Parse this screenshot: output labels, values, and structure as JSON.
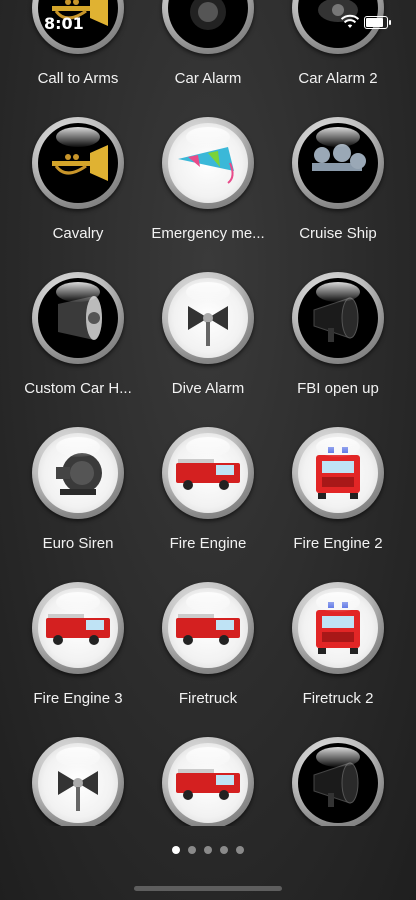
{
  "status_bar": {
    "time": "8:01"
  },
  "rows": [
    [
      "Call to Arms",
      "Car Alarm",
      "Car Alarm 2"
    ],
    [
      "Cavalry",
      "Emergency me...",
      "Cruise Ship"
    ],
    [
      "Custom Car H...",
      "Dive Alarm",
      "FBI open up"
    ],
    [
      "Euro Siren",
      "Fire Engine",
      "Fire Engine 2"
    ],
    [
      "Fire Engine 3",
      "Firetruck",
      "Firetruck 2"
    ],
    [
      "",
      "",
      ""
    ]
  ],
  "icons": [
    [
      "trumpet-icon",
      "speaker-icon",
      "horn-icon"
    ],
    [
      "trumpet-icon",
      "party-horn-icon",
      "air-horn-icon"
    ],
    [
      "loudspeaker-icon",
      "siren-horn-icon",
      "megaphone-icon"
    ],
    [
      "fan-siren-icon",
      "fire-engine-icon",
      "fire-truck-front-icon"
    ],
    [
      "fire-engine-icon",
      "fire-engine-icon",
      "fire-truck-front-icon"
    ],
    [
      "siren-horn-icon",
      "fire-engine-icon",
      "megaphone-icon"
    ]
  ],
  "pager": {
    "count": 5,
    "active": 0
  },
  "colors": {
    "background": "#2b2b2b",
    "label": "#f2f2f2",
    "dot_active": "#ffffff",
    "dot_inactive": "#8a8a8a"
  }
}
